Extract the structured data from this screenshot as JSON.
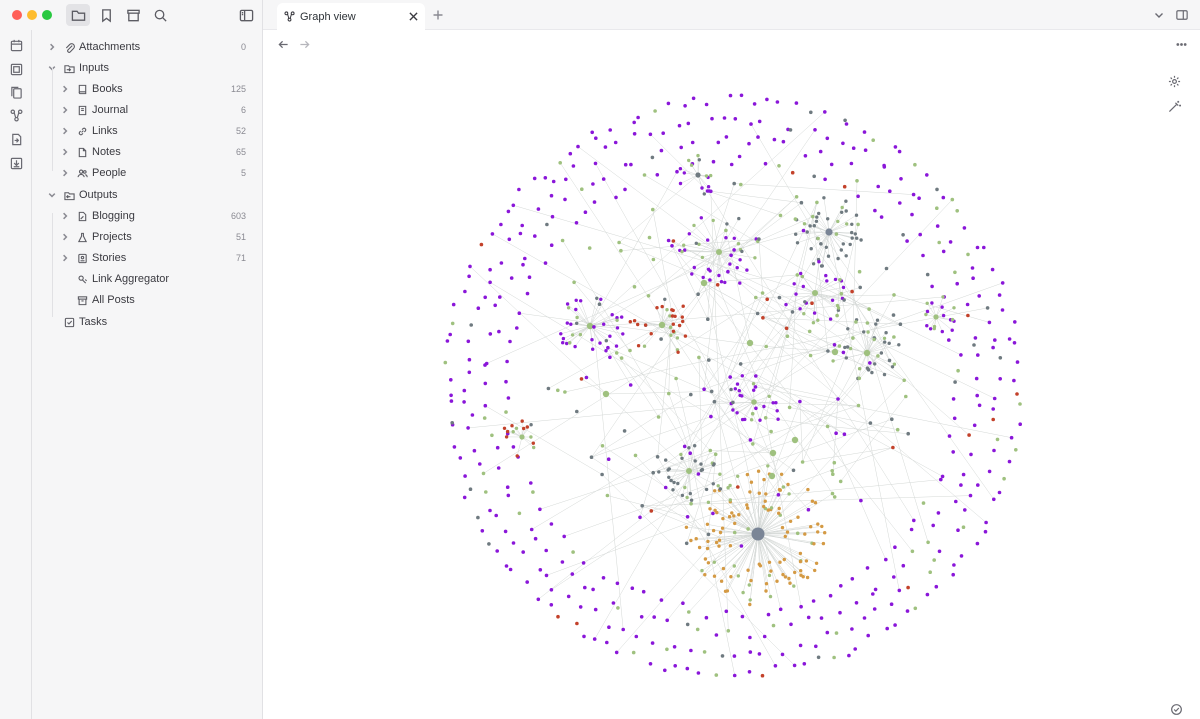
{
  "tab": {
    "title": "Graph view"
  },
  "sidebar": {
    "items": [
      {
        "label": "Attachments",
        "count": "0",
        "icon": "paperclip-icon",
        "level": 0
      },
      {
        "label": "Inputs",
        "count": "",
        "icon": "folder-input-icon",
        "level": 0,
        "expanded": true
      },
      {
        "label": "Books",
        "count": "125",
        "icon": "book-icon",
        "level": 1
      },
      {
        "label": "Journal",
        "count": "6",
        "icon": "journal-icon",
        "level": 1
      },
      {
        "label": "Links",
        "count": "52",
        "icon": "link-icon",
        "level": 1
      },
      {
        "label": "Notes",
        "count": "65",
        "icon": "note-icon",
        "level": 1
      },
      {
        "label": "People",
        "count": "5",
        "icon": "people-icon",
        "level": 1
      },
      {
        "label": "Outputs",
        "count": "",
        "icon": "folder-output-icon",
        "level": 0,
        "expanded": true
      },
      {
        "label": "Blogging",
        "count": "603",
        "icon": "file-pen-icon",
        "level": 1
      },
      {
        "label": "Projects",
        "count": "51",
        "icon": "flask-icon",
        "level": 1
      },
      {
        "label": "Stories",
        "count": "71",
        "icon": "story-icon",
        "level": 1
      },
      {
        "label": "Link Aggregator",
        "count": "",
        "icon": "link-aggregator-icon",
        "level": 1
      },
      {
        "label": "All Posts",
        "count": "",
        "icon": "archive-icon",
        "level": 1
      },
      {
        "label": "Tasks",
        "count": "",
        "icon": "checkbox-icon",
        "level": 0
      }
    ]
  },
  "graph": {
    "colors": {
      "purple": "#8a16d9",
      "green": "#9fc17f",
      "gray": "#6f7a80",
      "orange": "#d49a44",
      "red": "#c3412a",
      "edge": "#d4d8d6",
      "hub": "#7a8596"
    }
  }
}
